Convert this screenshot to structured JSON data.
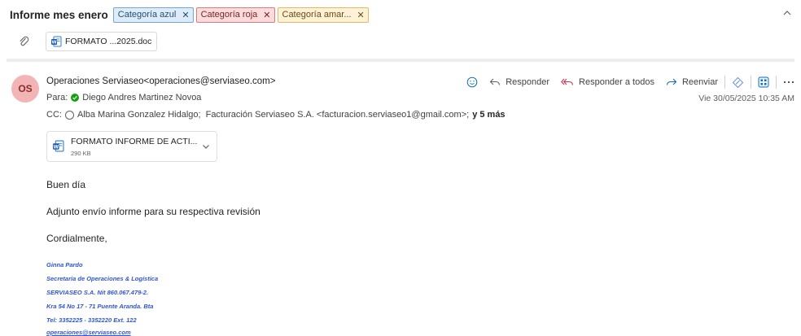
{
  "header": {
    "subject": "Informe mes enero",
    "categories": [
      {
        "label": "Categoría azul"
      },
      {
        "label": "Categoría roja"
      },
      {
        "label": "Categoría amar..."
      }
    ],
    "remove_glyph": "✕",
    "attachment_chip": "FORMATO ...2025.doc"
  },
  "message": {
    "avatar_initials": "OS",
    "sender": "Operaciones Serviaseo<operaciones@serviaseo.com>",
    "to_label": "Para:",
    "to_name": "Diego Andres Martinez Novoa",
    "cc_label": "CC:",
    "cc": [
      "Alba Marina Gonzalez Hidalgo;",
      "Facturación Serviaseo S.A. <facturacion.serviaseo1@gmail.com>;"
    ],
    "cc_more": "y 5 más",
    "timestamp": "Vie 30/05/2025 10:35 AM",
    "actions": {
      "reply": "Responder",
      "reply_all": "Responder a todos",
      "forward": "Reenviar"
    },
    "attachment": {
      "name": "FORMATO INFORME DE ACTI...",
      "size": "290 KB"
    },
    "body": [
      "Buen día",
      "Adjunto envío informe para su respectiva revisión",
      "Cordialmente,"
    ],
    "signature": [
      "Ginna Pardo",
      "Secretaria de Operaciones & Logística",
      "SERVIASEO S.A. Nit 860.067.479-2.",
      "Kra 54 No 17 - 71 Puente Aranda. Bta",
      "Tel: 3352225 - 3352220 Ext. 122",
      "operaciones@serviaseo.com"
    ]
  },
  "colors": {
    "accent": "#0f6cbd",
    "avatar_bg": "#f2b4b4",
    "signature": "#2f55d4"
  },
  "icons": [
    "paperclip-icon",
    "word-doc-icon",
    "chevron-up-icon",
    "status-available-icon",
    "emoji-icon",
    "reply-icon",
    "reply-all-icon",
    "forward-icon",
    "sensitivity-icon",
    "apps-icon",
    "more-icon",
    "chevron-down-icon"
  ]
}
